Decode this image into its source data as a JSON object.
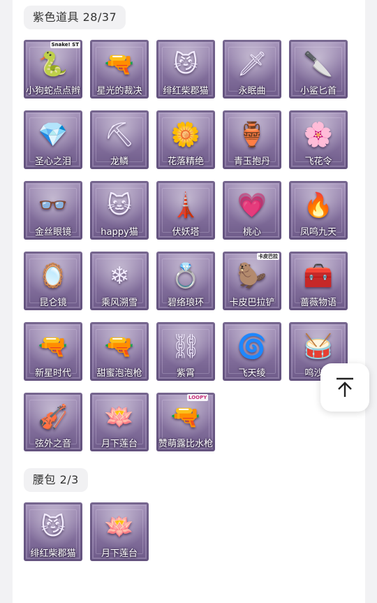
{
  "sections": [
    {
      "title": "紫色道具 28/37",
      "items": [
        {
          "label": "小狗蛇点点辫",
          "icon": "snake-figure",
          "glyph": "🐍",
          "badge": "Snake! ST"
        },
        {
          "label": "星光的裁决",
          "icon": "revolver",
          "glyph": "🔫"
        },
        {
          "label": "绯红柴郡猫",
          "icon": "cat-egg",
          "glyph": "😼"
        },
        {
          "label": "永眠曲",
          "icon": "sword",
          "glyph": "🗡"
        },
        {
          "label": "小鲨匕首",
          "icon": "dagger",
          "glyph": "🔪"
        },
        {
          "label": "圣心之泪",
          "icon": "gem-staff",
          "glyph": "💎"
        },
        {
          "label": "龙鳞",
          "icon": "shovel",
          "glyph": "⛏"
        },
        {
          "label": "花落精绝",
          "icon": "flower-staff",
          "glyph": "🌼"
        },
        {
          "label": "青玉抱丹",
          "icon": "jade-bottle",
          "glyph": "🏺"
        },
        {
          "label": "飞花令",
          "icon": "flower-ball",
          "glyph": "🌸"
        },
        {
          "label": "金丝眼镜",
          "icon": "glasses",
          "glyph": "👓"
        },
        {
          "label": "happy猫",
          "icon": "cat-figure",
          "glyph": "🐱"
        },
        {
          "label": "伏妖塔",
          "icon": "pagoda",
          "glyph": "🗼"
        },
        {
          "label": "桃心",
          "icon": "heart-wand",
          "glyph": "💗"
        },
        {
          "label": "凤鸣九天",
          "icon": "red-blade",
          "glyph": "🔥"
        },
        {
          "label": "昆仑镜",
          "icon": "mirror",
          "glyph": "🪞"
        },
        {
          "label": "乘风溯雪",
          "icon": "blue-armor",
          "glyph": "❄"
        },
        {
          "label": "碧络琅环",
          "icon": "jade-ring",
          "glyph": "💍"
        },
        {
          "label": "卡皮巴拉铲",
          "icon": "capybara",
          "glyph": "🦫",
          "badge": "卡皮巴拉"
        },
        {
          "label": "蔷薇物语",
          "icon": "first-aid-box",
          "glyph": "🧰"
        },
        {
          "label": "新星时代",
          "icon": "golden-pistol",
          "glyph": "🔫"
        },
        {
          "label": "甜蜜泡泡枪",
          "icon": "bubble-gun",
          "glyph": "🔫"
        },
        {
          "label": "紫霄",
          "icon": "chain-pendant",
          "glyph": "⛓"
        },
        {
          "label": "飞天绫",
          "icon": "ribbon",
          "glyph": "🌀"
        },
        {
          "label": "鸣沙鼓",
          "icon": "drum-staff",
          "glyph": "🥁"
        },
        {
          "label": "弦外之音",
          "icon": "instrument",
          "glyph": "🎻"
        },
        {
          "label": "月下莲台",
          "icon": "lotus-staff",
          "glyph": "🪷"
        },
        {
          "label": "赞萌露比水枪",
          "icon": "water-gun",
          "glyph": "🔫",
          "badge": "LOOPY"
        }
      ]
    },
    {
      "title": "腰包 2/3",
      "items": [
        {
          "label": "绯红柴郡猫",
          "icon": "cat-egg",
          "glyph": "😼"
        },
        {
          "label": "月下莲台",
          "icon": "lotus-staff",
          "glyph": "🪷"
        }
      ]
    }
  ],
  "scroll_top": {
    "icon": "arrow-up-to-top-icon"
  }
}
